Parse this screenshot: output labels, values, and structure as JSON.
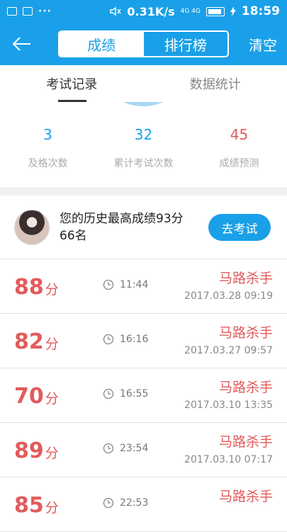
{
  "status_bar": {
    "speed": "0.31K/s",
    "network": "4G 4G",
    "time": "18:59",
    "left_icons": [
      "image-icon",
      "message-icon"
    ],
    "dots": "···"
  },
  "nav": {
    "back_icon": "back-arrow-icon",
    "tabs": [
      {
        "label": "成绩",
        "active": true
      },
      {
        "label": "排行榜",
        "active": false
      }
    ],
    "clear_label": "清空"
  },
  "sub_tabs": [
    {
      "label": "考试记录",
      "active": true
    },
    {
      "label": "数据统计",
      "active": false
    }
  ],
  "stats": [
    {
      "value": "3",
      "label": "及格次数",
      "color": "#1aa0e8"
    },
    {
      "value": "32",
      "label": "累计考试次数",
      "color": "#1aa0e8"
    },
    {
      "value": "45",
      "label": "成绩预测",
      "color": "#e25b5b"
    }
  ],
  "best": {
    "line1": "您的历史最高成绩93分",
    "line2": "66名",
    "button_label": "去考试"
  },
  "records": [
    {
      "score": "88",
      "unit": "分",
      "duration": "11:44",
      "name": "马路杀手",
      "date": "2017.03.28  09:19"
    },
    {
      "score": "82",
      "unit": "分",
      "duration": "16:16",
      "name": "马路杀手",
      "date": "2017.03.27  09:57"
    },
    {
      "score": "70",
      "unit": "分",
      "duration": "16:55",
      "name": "马路杀手",
      "date": "2017.03.10  13:35"
    },
    {
      "score": "89",
      "unit": "分",
      "duration": "23:54",
      "name": "马路杀手",
      "date": "2017.03.10  07:17"
    },
    {
      "score": "85",
      "unit": "分",
      "duration": "22:53",
      "name": "马路杀手",
      "date": ""
    }
  ],
  "colors": {
    "accent": "#1aa0e8",
    "score_red": "#e25b5b"
  }
}
